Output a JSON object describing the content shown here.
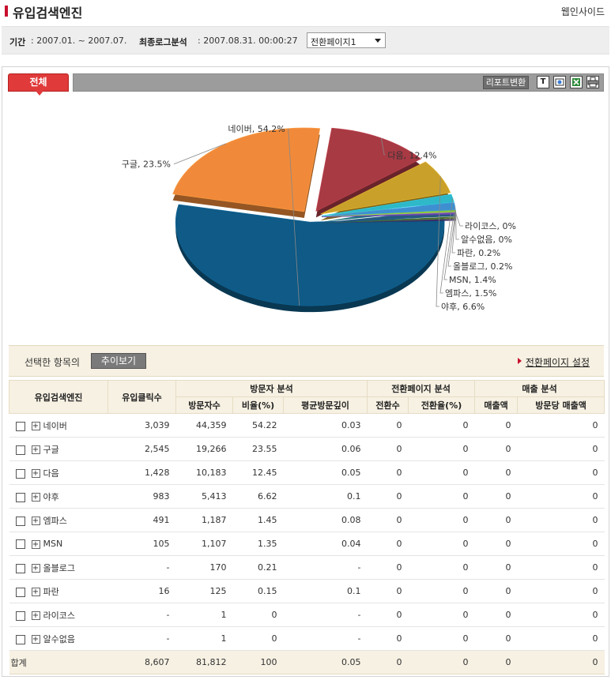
{
  "page": {
    "title": "유입검색엔진",
    "site_link": "웹인사이드"
  },
  "info": {
    "period_label": "기간",
    "period_value": ": 2007.01. ~ 2007.07.",
    "last_log_label": "최종로그분석",
    "last_log_value": ": 2007.08.31. 00:00:27",
    "page_select": "전환페이지1"
  },
  "toolbar": {
    "tab_all": "전체",
    "report_toggle": "리포트변환",
    "icons": [
      "text-icon",
      "web-icon",
      "excel-icon",
      "print-icon"
    ],
    "text_icon_glyph": "T"
  },
  "selection": {
    "label": "선택한 항목의",
    "trend_button": "추이보기",
    "conversion_link": "전환페이지 설정"
  },
  "table": {
    "groups": {
      "visitor": "방문자 분석",
      "conversion": "전환페이지 분석",
      "sales": "매출 분석"
    },
    "headers": {
      "engine": "유입검색엔진",
      "clicks": "유입클릭수",
      "visitors": "방문자수",
      "ratio": "비율(%)",
      "avg_depth": "평균방문깊이",
      "conversions": "전환수",
      "conv_rate": "전환율(%)",
      "sales": "매출액",
      "sales_per_visit": "방문당 매출액"
    },
    "rows": [
      {
        "name": "네이버",
        "clicks": "3,039",
        "visitors": "44,359",
        "ratio": "54.22",
        "depth": "0.03",
        "conv": "0",
        "rate": "0",
        "sales": "0",
        "spv": "0"
      },
      {
        "name": "구글",
        "clicks": "2,545",
        "visitors": "19,266",
        "ratio": "23.55",
        "depth": "0.06",
        "conv": "0",
        "rate": "0",
        "sales": "0",
        "spv": "0"
      },
      {
        "name": "다음",
        "clicks": "1,428",
        "visitors": "10,183",
        "ratio": "12.45",
        "depth": "0.05",
        "conv": "0",
        "rate": "0",
        "sales": "0",
        "spv": "0"
      },
      {
        "name": "야후",
        "clicks": "983",
        "visitors": "5,413",
        "ratio": "6.62",
        "depth": "0.1",
        "conv": "0",
        "rate": "0",
        "sales": "0",
        "spv": "0"
      },
      {
        "name": "엠파스",
        "clicks": "491",
        "visitors": "1,187",
        "ratio": "1.45",
        "depth": "0.08",
        "conv": "0",
        "rate": "0",
        "sales": "0",
        "spv": "0"
      },
      {
        "name": "MSN",
        "clicks": "105",
        "visitors": "1,107",
        "ratio": "1.35",
        "depth": "0.04",
        "conv": "0",
        "rate": "0",
        "sales": "0",
        "spv": "0"
      },
      {
        "name": "올블로그",
        "clicks": "-",
        "visitors": "170",
        "ratio": "0.21",
        "depth": "-",
        "conv": "0",
        "rate": "0",
        "sales": "0",
        "spv": "0"
      },
      {
        "name": "파란",
        "clicks": "16",
        "visitors": "125",
        "ratio": "0.15",
        "depth": "0.1",
        "conv": "0",
        "rate": "0",
        "sales": "0",
        "spv": "0"
      },
      {
        "name": "라이코스",
        "clicks": "-",
        "visitors": "1",
        "ratio": "0",
        "depth": "-",
        "conv": "0",
        "rate": "0",
        "sales": "0",
        "spv": "0"
      },
      {
        "name": "알수없음",
        "clicks": "-",
        "visitors": "1",
        "ratio": "0",
        "depth": "-",
        "conv": "0",
        "rate": "0",
        "sales": "0",
        "spv": "0"
      }
    ],
    "total": {
      "name": "합계",
      "clicks": "8,607",
      "visitors": "81,812",
      "ratio": "100",
      "depth": "0.05",
      "conv": "0",
      "rate": "0",
      "sales": "0",
      "spv": "0"
    }
  },
  "chart_data": {
    "type": "pie",
    "labels": [
      "네이버",
      "구글",
      "다음",
      "야후",
      "엠파스",
      "MSN",
      "올블로그",
      "파란",
      "알수없음",
      "라이코스"
    ],
    "values": [
      54.2,
      23.5,
      12.4,
      6.6,
      1.5,
      1.4,
      0.2,
      0.2,
      0,
      0
    ],
    "label_texts": [
      "네이버, 54.2%",
      "구글, 23.5%",
      "다음, 12.4%",
      "야후, 6.6%",
      "엠파스, 1.5%",
      "MSN, 1.4%",
      "올블로그, 0.2%",
      "파란, 0.2%",
      "알수없음, 0%",
      "라이코스, 0%"
    ],
    "colors": [
      "#0f5a86",
      "#f08a3a",
      "#a83a44",
      "#c9a02a",
      "#2eb8c8",
      "#3e8fd0",
      "#6fb03e",
      "#8fbf3a",
      "#7a55b0",
      "#5a3d9a"
    ]
  }
}
